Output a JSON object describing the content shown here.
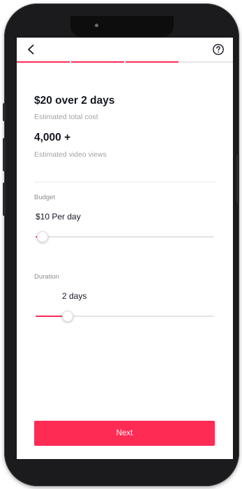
{
  "header": {
    "back_icon": "chevron-left-icon",
    "help_icon": "question-circle-icon",
    "progress": {
      "steps_total": 4,
      "steps_done": 3
    }
  },
  "summary": {
    "cost_title": "$20 over 2 days",
    "cost_label": "Estimated total cost",
    "views_title": "4,000 +",
    "views_label": "Estimated video views"
  },
  "budget": {
    "label": "Budget",
    "value": "$10 Per day",
    "slider_fraction": 0.04
  },
  "duration": {
    "label": "Duration",
    "value": "2 days",
    "slider_fraction": 0.18
  },
  "footer": {
    "next_label": "Next"
  },
  "colors": {
    "accent": "#fe2c55",
    "text_primary": "#161823",
    "text_secondary": "#a1a2a7"
  }
}
